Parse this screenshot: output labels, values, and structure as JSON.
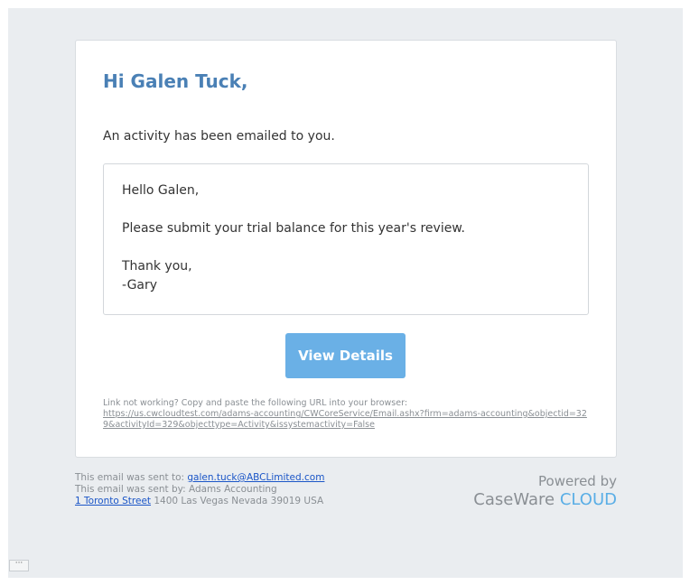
{
  "email": {
    "greeting": "Hi Galen Tuck,",
    "intro": "An activity has been emailed to you.",
    "message": {
      "line1": "Hello Galen,",
      "line2": "Please submit your trial balance for this year's review.",
      "line3": "Thank you,",
      "line4": "-Gary"
    },
    "button_label": "View Details",
    "link_help": "Link not working? Copy and paste the following URL into your browser:",
    "link_url": "https://us.cwcloudtest.com/adams-accounting/CWCoreService/Email.ashx?firm=adams-accounting&objectid=329&activityId=329&objecttype=Activity&issystemactivity=False"
  },
  "footer": {
    "sent_to_label": "This email was sent to:",
    "sent_to_email": "galen.tuck@ABCLimited.com",
    "sent_by": "This email was sent by: Adams Accounting",
    "address_street": "1 Toronto Street",
    "address_rest": "1400 Las Vegas Nevada 39019 USA",
    "powered_by": "Powered by",
    "brand_name": "CaseWare",
    "brand_suffix": "CLOUD"
  },
  "toolbar": {
    "more_label": "···"
  },
  "colors": {
    "greeting": "#4a80b5",
    "button": "#6ab0e6",
    "cloud": "#5aaee6",
    "background": "#eaedf0"
  }
}
